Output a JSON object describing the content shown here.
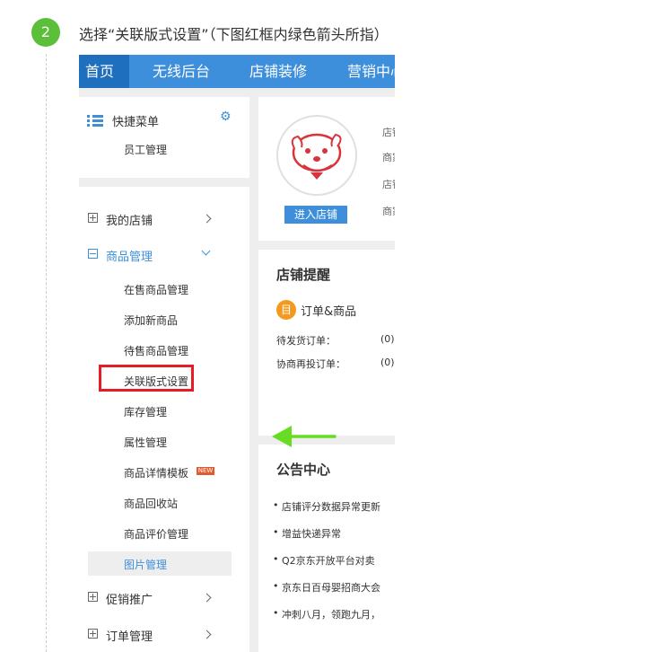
{
  "step": {
    "number": "2",
    "instruction": "选择“关联版式设置”（下图红框内绿色箭头所指）"
  },
  "colors": {
    "nav_blue": "#3d8fdc",
    "nav_home": "#1f6fbf",
    "step_green": "#5cbf3a",
    "highlight_red": "#e51c23",
    "arrow_green": "#66dd22"
  },
  "topnav": {
    "items": [
      "首页",
      "无线后台",
      "店铺装修",
      "营销中心"
    ]
  },
  "sidebar": {
    "quick_menu": {
      "title": "快捷菜单",
      "items": [
        "员工管理"
      ]
    },
    "menus": [
      {
        "label": "我的店铺"
      },
      {
        "label": "商品管理"
      },
      {
        "label": "促销推广"
      },
      {
        "label": "订单管理"
      }
    ],
    "product_submenu": [
      "在售商品管理",
      "添加新商品",
      "待售商品管理",
      "关联版式设置",
      "库存管理",
      "属性管理",
      "商品详情模板",
      "商品回收站",
      "商品评价管理",
      "图片管理"
    ],
    "new_badge": "NEW"
  },
  "store": {
    "enter_button": "进入店铺",
    "info_lines": [
      "店铺",
      "商家",
      "店铺",
      "商家"
    ]
  },
  "reminder": {
    "title": "店铺提醒",
    "section_icon_glyph": "目",
    "section": "订单&商品",
    "rows": [
      {
        "label": "待发货订单：",
        "value": "(0)"
      },
      {
        "label": "协商再投订单：",
        "value": "(0)"
      }
    ]
  },
  "notice": {
    "title": "公告中心",
    "items": [
      "店铺评分数据异常更新",
      "增益快递异常",
      "Q2京东开放平台对卖",
      "京东日百母婴招商大会",
      "冲刺八月，领跑九月，"
    ]
  }
}
